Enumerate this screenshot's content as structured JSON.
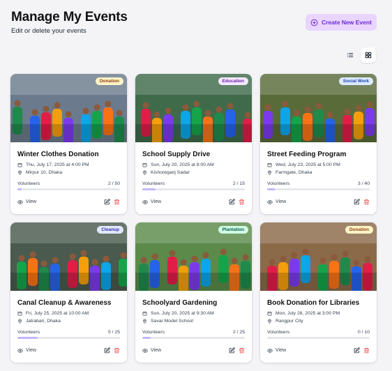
{
  "header": {
    "title": "Manage My Events",
    "subtitle": "Edit or delete your events",
    "create_label": "Create New Event"
  },
  "view_toggle": {
    "active": "grid"
  },
  "events": [
    {
      "title": "Winter Clothes Donation",
      "date": "Thu, July 17, 2025 at 4:00 PM",
      "location": "Mirpur 10, Dhaka",
      "category": "Donation",
      "badge_bg": "#fef3c7",
      "badge_color": "#92400e",
      "volunteers_label": "Volunteers",
      "volunteers": "2 / 50",
      "progress": 0.04,
      "view_label": "View",
      "scene": "#6b7a8c"
    },
    {
      "title": "School Supply Drive",
      "date": "Sun, July 20, 2025 at 8:00 AM",
      "location": "Kishoreganj Sadar",
      "category": "Education",
      "badge_bg": "#f3e8ff",
      "badge_color": "#6b21a8",
      "volunteers_label": "Volunteers",
      "volunteers": "2 / 15",
      "progress": 0.13,
      "view_label": "View",
      "scene": "#3f6b4a"
    },
    {
      "title": "Street Feeding Program",
      "date": "Wed, July 23, 2025 at 5:00 PM",
      "location": "Farmgate, Dhaka",
      "category": "Social Work",
      "badge_bg": "#dbeafe",
      "badge_color": "#1e40af",
      "volunteers_label": "Volunteers",
      "volunteers": "3 / 40",
      "progress": 0.075,
      "view_label": "View",
      "scene": "#5a6b3a"
    },
    {
      "title": "Canal Cleanup & Awareness",
      "date": "Fri, July 25, 2025 at 10:00 AM",
      "location": "Jatrabari, Dhaka",
      "category": "Cleanup",
      "badge_bg": "#e0e7ff",
      "badge_color": "#3730a3",
      "volunteers_label": "Volunteers",
      "volunteers": "5 / 25",
      "progress": 0.2,
      "view_label": "View",
      "scene": "#4a5a4e"
    },
    {
      "title": "Schoolyard Gardening",
      "date": "Sun, July 20, 2025 at 9:30 AM",
      "location": "Savar Model School",
      "category": "Plantation",
      "badge_bg": "#d1fae5",
      "badge_color": "#065f46",
      "volunteers_label": "Volunteers",
      "volunteers": "2 / 25",
      "progress": 0.08,
      "view_label": "View",
      "scene": "#5b8a4a"
    },
    {
      "title": "Book Donation for Libraries",
      "date": "Mon, July 28, 2025 at 3:00 PM",
      "location": "Rangpur City",
      "category": "Donation",
      "badge_bg": "#fef3c7",
      "badge_color": "#92400e",
      "volunteers_label": "Volunteers",
      "volunteers": "0 / 10",
      "progress": 0.0,
      "view_label": "View",
      "scene": "#8a6a48"
    }
  ]
}
